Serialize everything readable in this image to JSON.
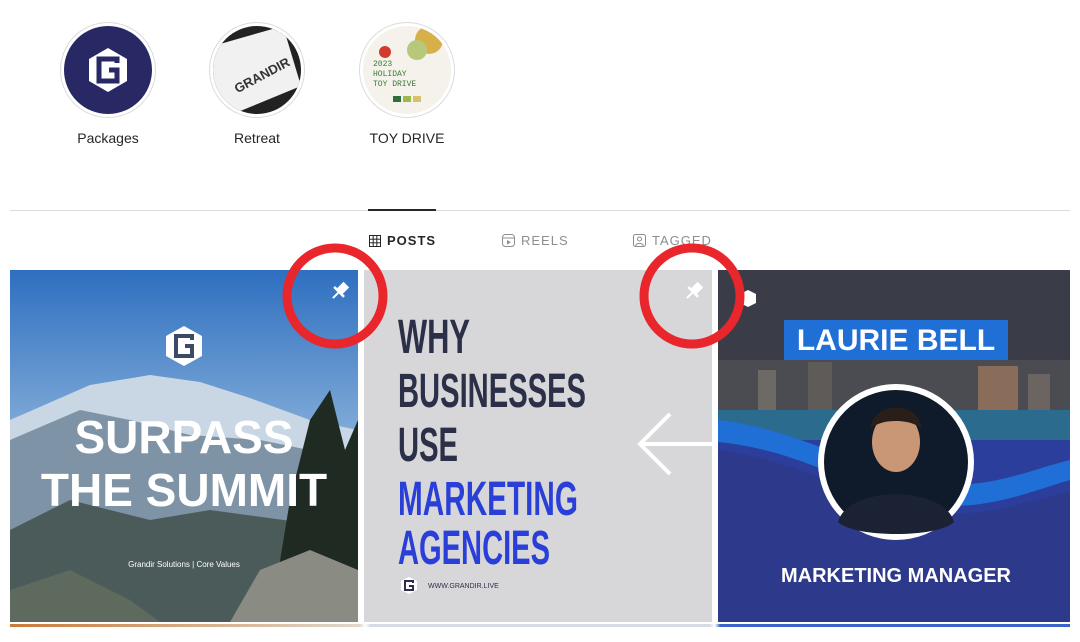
{
  "highlights": [
    {
      "label": "Packages",
      "icon": "grandir-logo-icon"
    },
    {
      "label": "Retreat",
      "card_text": "GRANDIR"
    },
    {
      "label": "TOY DRIVE",
      "cover_lines": [
        "2023",
        "HOLIDAY",
        "TOY DRIVE"
      ]
    }
  ],
  "tabs": [
    {
      "label": "POSTS",
      "icon": "grid-icon",
      "active": true
    },
    {
      "label": "REELS",
      "icon": "reels-icon",
      "active": false
    },
    {
      "label": "TAGGED",
      "icon": "tagged-icon",
      "active": false
    }
  ],
  "posts": [
    {
      "pinned": true,
      "headline_lines": [
        "SURPASS",
        "THE SUMMIT"
      ],
      "caption": "Grandir Solutions | Core Values"
    },
    {
      "pinned": true,
      "headline_dark": [
        "WHY",
        "BUSINESSES",
        "USE"
      ],
      "headline_accent": [
        "MARKETING",
        "AGENCIES"
      ],
      "website": "WWW.GRANDIR.LIVE",
      "arrow": "left-arrow-icon"
    },
    {
      "pinned": false,
      "name": "LAURIE BELL",
      "title": "MARKETING MANAGER"
    }
  ],
  "colors": {
    "annotation_red": "#e8262c",
    "brand_navy": "#282864",
    "accent_blue": "#2a3fd8",
    "dark_text": "#2b2f48",
    "banner_blue": "#1f6fd6"
  }
}
